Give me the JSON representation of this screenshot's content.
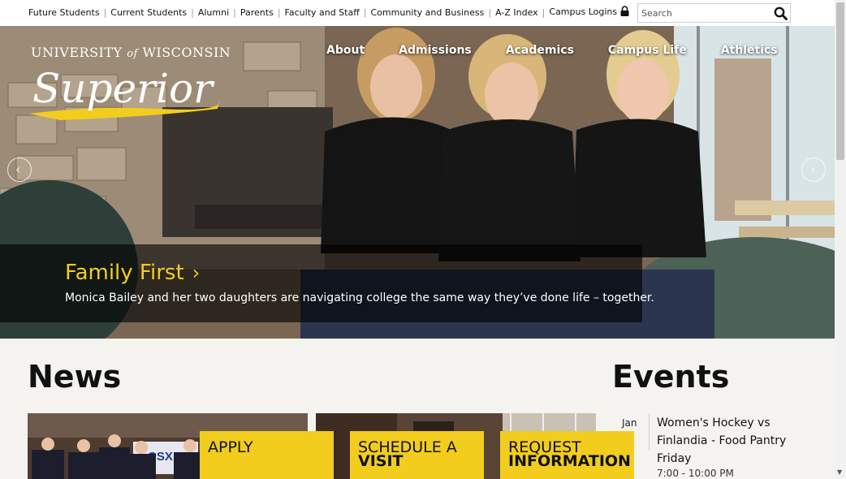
{
  "utility_nav": {
    "links": [
      "Future Students",
      "Current Students",
      "Alumni",
      "Parents",
      "Faculty and Staff",
      "Community and Business",
      "A-Z Index",
      "Campus Logins"
    ],
    "search_placeholder": "Search"
  },
  "logo": {
    "line1_a": "UNIVERSITY",
    "line1_of": "of",
    "line1_b": "WISCONSIN",
    "script": "Superior"
  },
  "main_nav": [
    "About",
    "Admissions",
    "Academics",
    "Campus Life",
    "Athletics"
  ],
  "hero": {
    "title": "Family First",
    "subtitle": "Monica Bailey and her two daughters are navigating college the same way they’ve done life – together."
  },
  "news": {
    "heading": "News",
    "photo_banner_text": "CSX"
  },
  "cta_buttons": [
    {
      "line1": "APPLY",
      "line2": ""
    },
    {
      "line1": "SCHEDULE A",
      "line2": "VISIT"
    },
    {
      "line1": "REQUEST",
      "line2": "INFORMATION"
    }
  ],
  "events": {
    "heading": "Events",
    "items": [
      {
        "month": "Jan",
        "title": "Women's Hockey vs Finlandia - Food Pantry Friday",
        "time": "7:00 - 10:00 PM"
      }
    ]
  },
  "colors": {
    "accent_gold": "#f2cd1d",
    "text_dark": "#111111",
    "page_bg": "#f5f3ef"
  }
}
